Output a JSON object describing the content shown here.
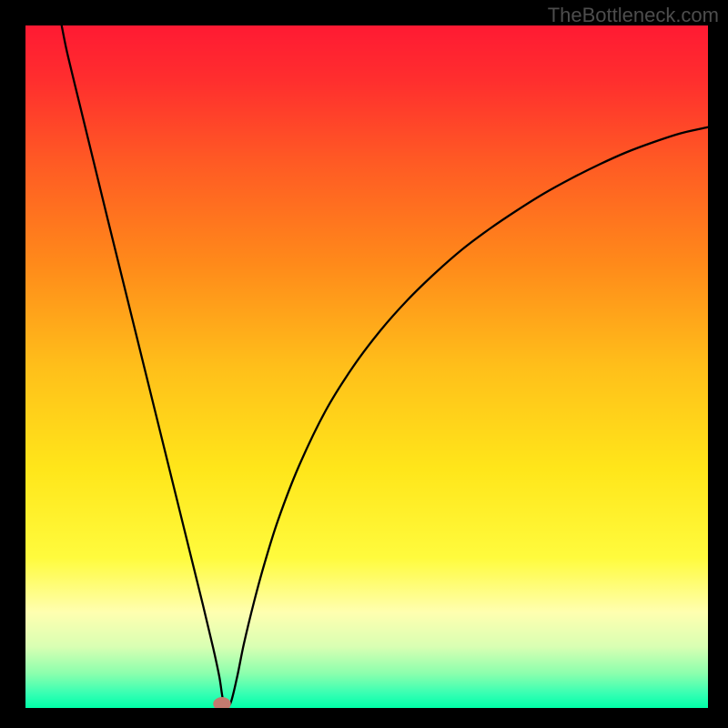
{
  "watermark": "TheBottleneck.com",
  "chart_data": {
    "type": "line",
    "title": "",
    "xlabel": "",
    "ylabel": "",
    "xlim": [
      0,
      100
    ],
    "ylim": [
      0,
      100
    ],
    "grid": false,
    "legend": false,
    "background": {
      "type": "vertical-gradient",
      "stops": [
        {
          "offset": 0.0,
          "color": "#ff1a33"
        },
        {
          "offset": 0.08,
          "color": "#ff2e2e"
        },
        {
          "offset": 0.2,
          "color": "#ff5a24"
        },
        {
          "offset": 0.35,
          "color": "#ff8a1a"
        },
        {
          "offset": 0.5,
          "color": "#ffbf1a"
        },
        {
          "offset": 0.65,
          "color": "#ffe61a"
        },
        {
          "offset": 0.78,
          "color": "#fffb3d"
        },
        {
          "offset": 0.86,
          "color": "#ffffb0"
        },
        {
          "offset": 0.91,
          "color": "#d9ffb3"
        },
        {
          "offset": 0.95,
          "color": "#8affad"
        },
        {
          "offset": 0.98,
          "color": "#33ffb3"
        },
        {
          "offset": 1.0,
          "color": "#00ffa8"
        }
      ]
    },
    "series": [
      {
        "name": "curve",
        "color": "#000000",
        "x": [
          5.3,
          6,
          7,
          8,
          10,
          12,
          14,
          16,
          18,
          20,
          22,
          24,
          26,
          27.5,
          28.4,
          29.1,
          30,
          31,
          32,
          33.5,
          35,
          37,
          40,
          44,
          48,
          52,
          56,
          60,
          64,
          68,
          72,
          76,
          80,
          84,
          88,
          92,
          96,
          100
        ],
        "y": [
          100,
          96.5,
          92.3,
          88.2,
          80.0,
          71.8,
          63.7,
          55.6,
          47.5,
          39.4,
          31.3,
          23.2,
          15.1,
          8.8,
          4.6,
          0.5,
          0.6,
          4.5,
          9.4,
          15.6,
          21.1,
          27.5,
          35.3,
          43.6,
          50.0,
          55.3,
          59.8,
          63.7,
          67.2,
          70.2,
          72.9,
          75.4,
          77.6,
          79.6,
          81.4,
          82.9,
          84.2,
          85.1
        ]
      }
    ],
    "marker": {
      "x": 28.8,
      "y": 0.6,
      "rx": 1.3,
      "ry": 1.0,
      "color": "#c27a6f"
    }
  }
}
